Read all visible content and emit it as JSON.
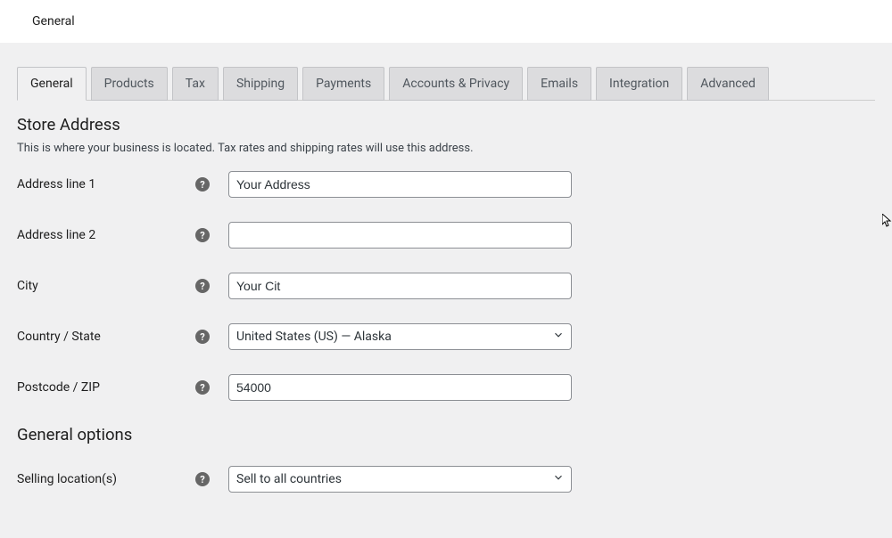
{
  "header": {
    "title": "General"
  },
  "tabs": [
    {
      "label": "General",
      "active": true
    },
    {
      "label": "Products",
      "active": false
    },
    {
      "label": "Tax",
      "active": false
    },
    {
      "label": "Shipping",
      "active": false
    },
    {
      "label": "Payments",
      "active": false
    },
    {
      "label": "Accounts & Privacy",
      "active": false
    },
    {
      "label": "Emails",
      "active": false
    },
    {
      "label": "Integration",
      "active": false
    },
    {
      "label": "Advanced",
      "active": false
    }
  ],
  "section1": {
    "title": "Store Address",
    "desc": "This is where your business is located. Tax rates and shipping rates will use this address."
  },
  "fields": {
    "address1": {
      "label": "Address line 1",
      "value": "Your Address"
    },
    "address2": {
      "label": "Address line 2",
      "value": ""
    },
    "city": {
      "label": "City",
      "value": "Your Cit"
    },
    "country": {
      "label": "Country / State",
      "value": "United States (US) — Alaska"
    },
    "postcode": {
      "label": "Postcode / ZIP",
      "value": "54000"
    }
  },
  "section2": {
    "title": "General options"
  },
  "fields2": {
    "selling": {
      "label": "Selling location(s)",
      "value": "Sell to all countries"
    }
  }
}
